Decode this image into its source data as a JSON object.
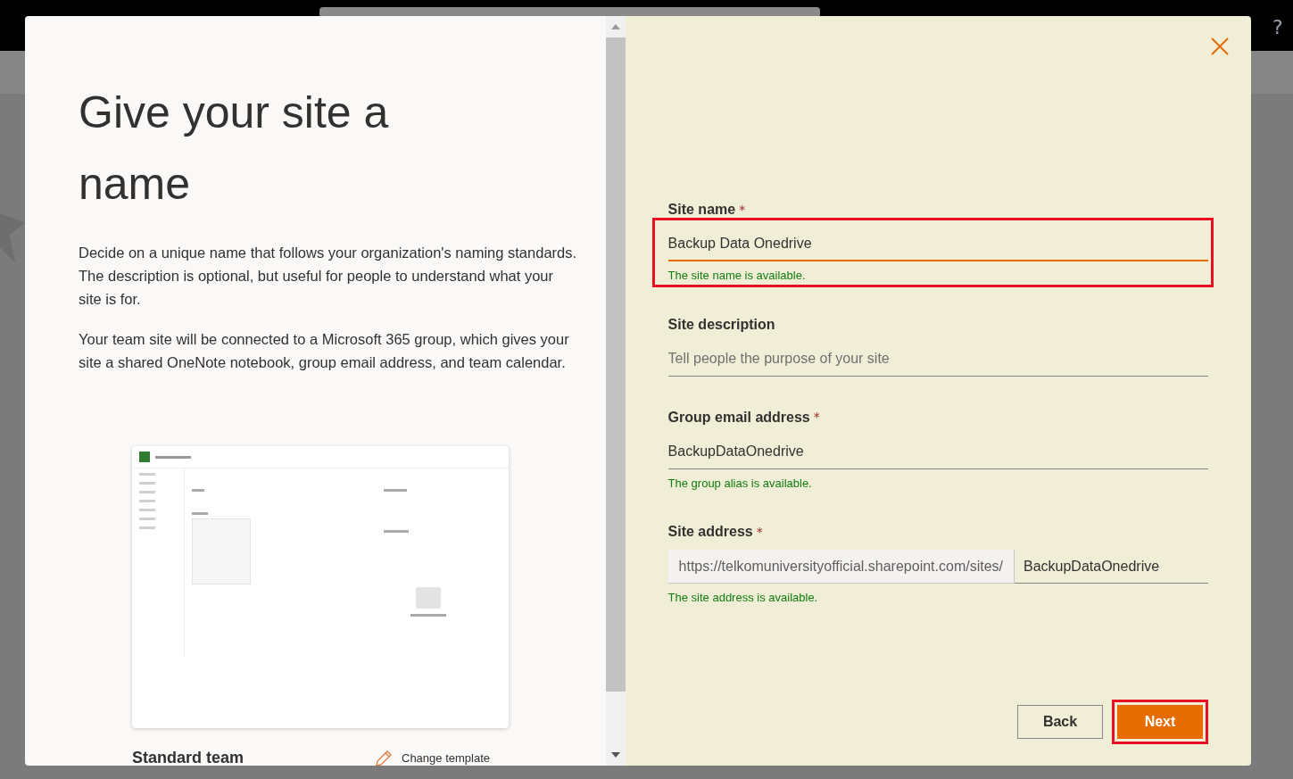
{
  "background": {
    "help": "?"
  },
  "dialog": {
    "title": "Give your site a name",
    "paragraphs": [
      "Decide on a unique name that follows your organization's naming standards. The description is optional, but useful for people to understand what your site is for.",
      "Your team site will be connected to a Microsoft 365 group, which gives your site a shared OneNote notebook, group email address, and team calendar."
    ],
    "template_name": "Standard team",
    "change_template": "Change template",
    "fields": [
      {
        "kind": "text",
        "label": "Site name",
        "required_mark": "*",
        "value": "Backup Data Onedrive",
        "focused": true,
        "highlighted": true,
        "message": "The site name is available."
      },
      {
        "kind": "text",
        "label": "Site description",
        "placeholder": "Tell people the purpose of your site",
        "focused": false,
        "highlighted": false
      },
      {
        "kind": "text",
        "label": "Group email address",
        "required_mark": "*",
        "value": "BackupDataOnedrive",
        "focused": false,
        "highlighted": false,
        "message": "The group alias is available."
      },
      {
        "kind": "address",
        "label": "Site address",
        "required_mark": "*",
        "prefix": "https://telkomuniversityofficial.sharepoint.com/sites/",
        "value": "BackupDataOnedrive",
        "focused": false,
        "highlighted": false,
        "message": "The site address is available."
      }
    ],
    "buttons": [
      {
        "kind": "secondary",
        "label": "Back",
        "highlighted": false
      },
      {
        "kind": "primary",
        "label": "Next",
        "highlighted": true
      }
    ]
  }
}
